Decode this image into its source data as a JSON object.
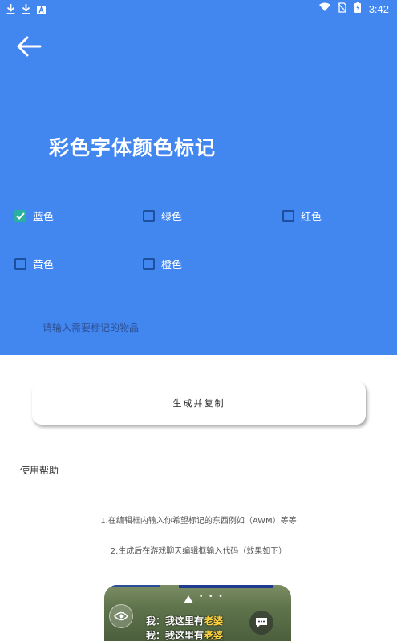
{
  "status_bar": {
    "left_icons": [
      "download-icon",
      "download-icon",
      "text-a-icon"
    ],
    "right_icons": [
      "wifi-icon",
      "no-sim-icon",
      "battery-icon"
    ],
    "time": "3:42"
  },
  "header": {
    "title": "彩色字体颜色标记",
    "background_color": "#4286f0"
  },
  "colors": [
    {
      "label": "蓝色",
      "checked": true
    },
    {
      "label": "绿色",
      "checked": false
    },
    {
      "label": "红色",
      "checked": false
    },
    {
      "label": "黄色",
      "checked": false
    },
    {
      "label": "橙色",
      "checked": false
    }
  ],
  "item_input": {
    "placeholder": "请输入需要标记的物品",
    "value": ""
  },
  "generate_button": {
    "label": "生成并复制"
  },
  "help": {
    "title": "使用帮助",
    "lines": [
      "1.在编辑框内输入你希望标记的东西例如（AWM）等等",
      "2.生成后在游戏聊天编辑框输入代码（效果如下）"
    ]
  },
  "example_image": {
    "chat_lines": [
      {
        "prefix": "我：我这里有",
        "highlight": "老婆"
      },
      {
        "prefix": "我：我这里有",
        "highlight": "老婆"
      }
    ]
  }
}
